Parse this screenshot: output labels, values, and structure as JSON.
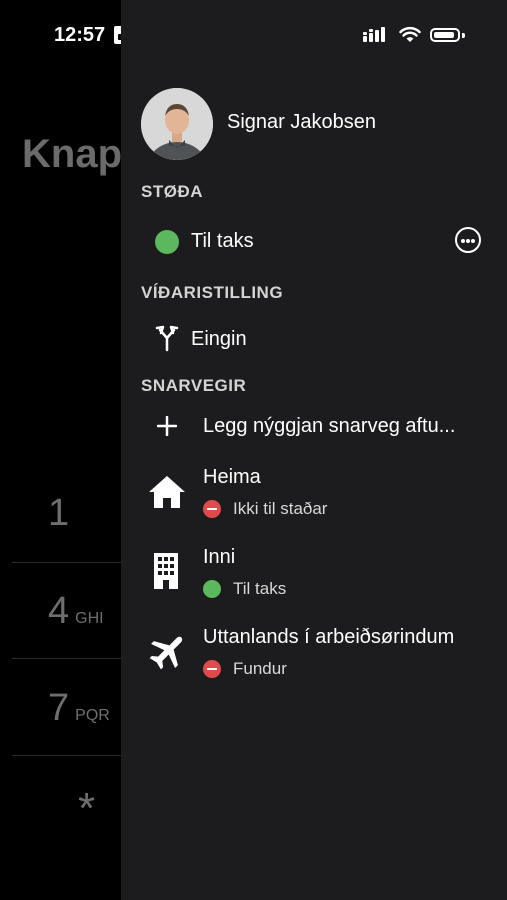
{
  "status_bar": {
    "time": "12:57"
  },
  "background": {
    "title": "Knap",
    "keys": [
      {
        "digit": "1",
        "letters": ""
      },
      {
        "digit": "4",
        "letters": "GHI"
      },
      {
        "digit": "7",
        "letters": "PQR"
      },
      {
        "digit": "*",
        "letters": ""
      }
    ]
  },
  "drawer": {
    "user_name": "Signar Jakobsen",
    "status_section": {
      "label": "STØÐA",
      "value": "Til taks"
    },
    "forward_section": {
      "label": "VÍÐARISTILLING",
      "value": "Eingin"
    },
    "shortcuts_section": {
      "label": "SNARVEGIR",
      "add_label": "Legg nýggjan snarveg aftu...",
      "items": [
        {
          "title": "Heima",
          "status": "Ikki til staðar",
          "icon": "home-icon",
          "status_color": "#e04a4a"
        },
        {
          "title": "Inni",
          "status": "Til taks",
          "icon": "building-icon",
          "status_color": "#5cb85c"
        },
        {
          "title": "Uttanlands í arbeiðsørindum",
          "status": "Fundur",
          "icon": "airplane-icon",
          "status_color": "#e04a4a"
        }
      ]
    }
  },
  "colors": {
    "drawer_bg": "#1c1c1e",
    "available": "#5cb85c",
    "busy": "#e04a4a"
  }
}
